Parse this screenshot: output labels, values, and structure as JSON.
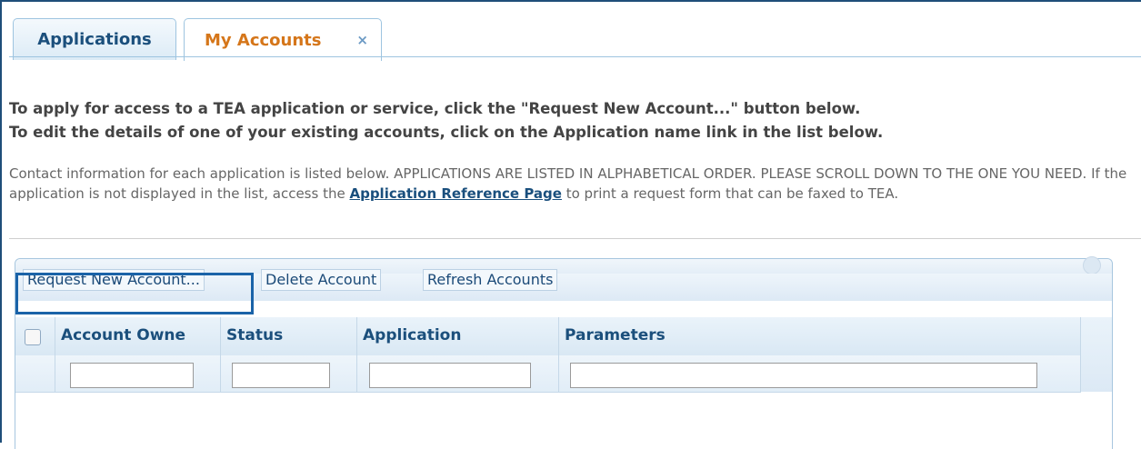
{
  "tabs": [
    {
      "label": "Applications"
    },
    {
      "label": "My Accounts",
      "close": "×"
    }
  ],
  "instructions": {
    "line1": "To apply for access to a TEA application or service, click the \"Request New Account...\" button below.",
    "line2": "To edit the details of one of your existing accounts, click on the Application name link in the list below."
  },
  "contact": {
    "text_before": "Contact information for each application is listed below. APPLICATIONS ARE LISTED IN ALPHABETICAL ORDER. PLEASE SCROLL DOWN TO THE ONE YOU NEED. If the application is not displayed in the list, access the ",
    "link": "Application Reference Page",
    "text_after": " to print a request form that can be faxed to TEA."
  },
  "toolbar": {
    "request_label": "Request New Account...",
    "delete_label": "Delete Account",
    "refresh_label": "Refresh Accounts"
  },
  "grid": {
    "columns": [
      "Account Owne",
      "Status",
      "Application",
      "Parameters"
    ]
  },
  "colors": {
    "accent": "#1b4f7c",
    "active_tab": "#d5761a",
    "highlight": "#1a63a8"
  }
}
